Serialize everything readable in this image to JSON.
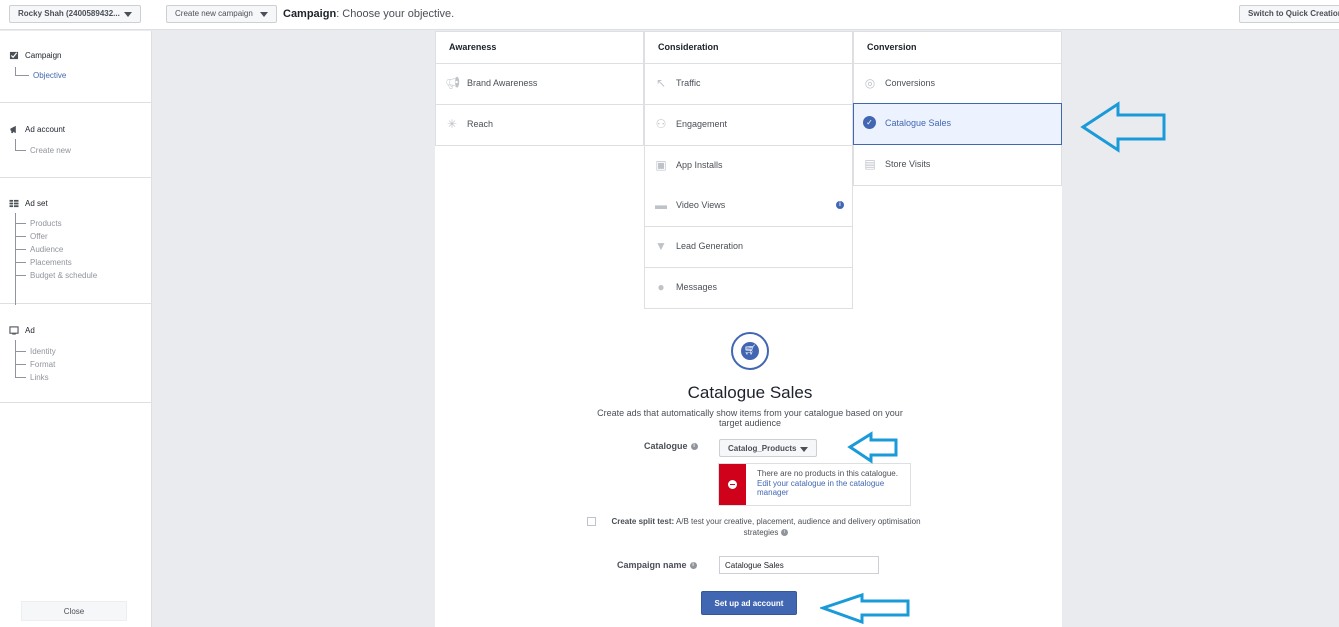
{
  "topbar": {
    "account": "Rocky Shah (2400589432...",
    "create_label": "Create new campaign",
    "title_bold": "Campaign",
    "title_rest": ": Choose your objective.",
    "quick_label": "Switch to Quick Creation"
  },
  "sidebar": {
    "campaign": {
      "label": "Campaign",
      "items": [
        "Objective"
      ]
    },
    "ad_account": {
      "label": "Ad account",
      "items": [
        "Create new"
      ]
    },
    "ad_set": {
      "label": "Ad set",
      "items": [
        "Products",
        "Offer",
        "Audience",
        "Placements",
        "Budget & schedule"
      ]
    },
    "ad": {
      "label": "Ad",
      "items": [
        "Identity",
        "Format",
        "Links"
      ]
    },
    "close_label": "Close"
  },
  "objectives": {
    "awareness": {
      "header": "Awareness",
      "items": [
        "Brand Awareness",
        "Reach"
      ]
    },
    "consideration": {
      "header": "Consideration",
      "items": [
        "Traffic",
        "Engagement",
        "App Installs",
        "Video Views",
        "Lead Generation",
        "Messages"
      ]
    },
    "conversion": {
      "header": "Conversion",
      "items": [
        "Conversions",
        "Catalogue Sales",
        "Store Visits"
      ]
    },
    "selected": "Catalogue Sales"
  },
  "detail": {
    "title": "Catalogue Sales",
    "description": "Create ads that automatically show items from your catalogue based on your target audience",
    "catalogue_label": "Catalogue",
    "catalogue_value": "Catalog_Products",
    "error_text": "There are no products in this catalogue.",
    "error_link": "Edit your catalogue in the catalogue manager",
    "split_bold": "Create split test:",
    "split_text": " A/B test your creative, placement, audience and delivery optimisation strategies",
    "campaign_name_label": "Campaign name",
    "campaign_name_value": "Catalogue Sales",
    "setup_button": "Set up ad account"
  },
  "colors": {
    "accent": "#4267b2",
    "annotation_arrow": "#1a9ad9",
    "error": "#d0021b"
  }
}
